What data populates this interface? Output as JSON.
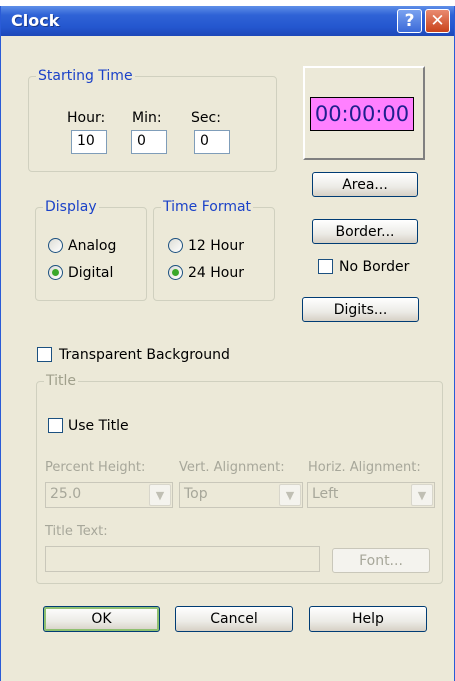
{
  "window": {
    "title": "Clock",
    "help_glyph": "?",
    "close_glyph": "✕"
  },
  "starting_time": {
    "legend": "Starting Time",
    "hour_label": "Hour:",
    "min_label": "Min:",
    "sec_label": "Sec:",
    "hour_value": "10",
    "min_value": "0",
    "sec_value": "0"
  },
  "preview": {
    "text": "00:00:00",
    "color": "#ff80ff"
  },
  "buttons": {
    "area": "Area...",
    "border": "Border...",
    "digits": "Digits...",
    "ok": "OK",
    "cancel": "Cancel",
    "help": "Help"
  },
  "no_border": {
    "label": "No Border",
    "checked": false
  },
  "display": {
    "legend": "Display",
    "options": [
      "Analog",
      "Digital"
    ],
    "selected": "Digital"
  },
  "time_format": {
    "legend": "Time Format",
    "options": [
      "12 Hour",
      "24 Hour"
    ],
    "selected": "24 Hour"
  },
  "transparent_background": {
    "label": "Transparent Background",
    "checked": false
  },
  "title_group": {
    "legend": "Title",
    "use_title_label": "Use Title",
    "percent_height_label": "Percent Height:",
    "vert_alignment_label": "Vert. Alignment:",
    "horiz_alignment_label": "Horiz. Alignment:",
    "percent_height_value": "25.0",
    "vert_alignment_value": "Top",
    "horiz_alignment_value": "Left",
    "title_text_label": "Title Text:",
    "title_text_value": "",
    "font_button": "Font..."
  }
}
